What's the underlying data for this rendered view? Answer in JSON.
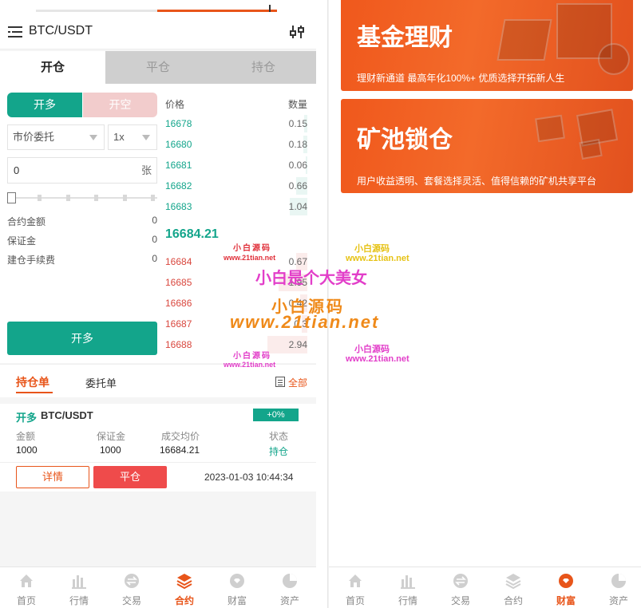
{
  "left": {
    "pair": "BTC/USDT",
    "tabs": [
      "开仓",
      "平仓",
      "持仓"
    ],
    "side_buttons": {
      "long": "开多",
      "short": "开空"
    },
    "order_type": "市价委托",
    "leverage": "1x",
    "quantity": {
      "value": "0",
      "unit": "张"
    },
    "info": [
      {
        "label": "合约金额",
        "value": "0"
      },
      {
        "label": "保证金",
        "value": "0"
      },
      {
        "label": "建仓手续费",
        "value": "0"
      }
    ],
    "submit": "开多",
    "book": {
      "price_header": "价格",
      "qty_header": "数量",
      "buys": [
        {
          "price": "16678",
          "qty": "0.15"
        },
        {
          "price": "16680",
          "qty": "0.18"
        },
        {
          "price": "16681",
          "qty": "0.06"
        },
        {
          "price": "16682",
          "qty": "0.66"
        },
        {
          "price": "16683",
          "qty": "1.04"
        }
      ],
      "last_price": "16684.21",
      "sells": [
        {
          "price": "16684",
          "qty": "0.67"
        },
        {
          "price": "16685",
          "qty": "1.95"
        },
        {
          "price": "16686",
          "qty": "0.42"
        },
        {
          "price": "16687",
          "qty": "0.3"
        },
        {
          "price": "16688",
          "qty": "2.94"
        }
      ]
    },
    "order_tabs": {
      "positions": "持仓单",
      "orders": "委托单",
      "all": "全部"
    },
    "position": {
      "side": "开多",
      "pair": "BTC/USDT",
      "pnl": "+0%",
      "labels": [
        "金额",
        "保证金",
        "成交均价",
        "状态"
      ],
      "values": [
        "1000",
        "1000",
        "16684.21",
        "持仓"
      ],
      "detail": "详情",
      "close": "平仓",
      "time": "2023-01-03 10:44:34"
    }
  },
  "nav": [
    "首页",
    "行情",
    "交易",
    "合约",
    "财富",
    "资产"
  ],
  "right": {
    "banners": [
      {
        "title": "基金理财",
        "subtitle": "理财新通道 最高年化100%+ 优质选择开拓新人生"
      },
      {
        "title": "矿池锁仓",
        "subtitle": "用户收益透明、套餐选择灵活、值得信赖的矿机共享平台"
      }
    ]
  },
  "watermarks": {
    "small_brand": "小白源码",
    "small_url": "www.21tian.net",
    "big_line": "小白是个大美女",
    "big_brand": "小白源码",
    "big_url": "www.21tian.net"
  },
  "colors": {
    "green": "#13a58b",
    "red": "#ef4b4b",
    "orange": "#e8551a"
  }
}
